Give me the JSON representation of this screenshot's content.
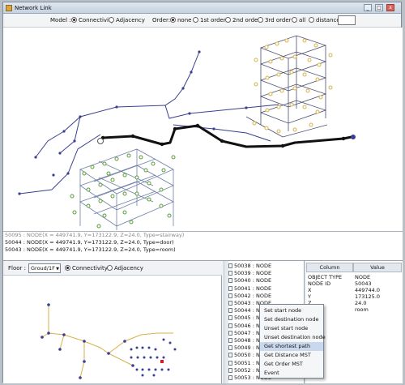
{
  "window": {
    "title": "Network Link",
    "minimize": "_",
    "maximize": "□",
    "close": "x"
  },
  "toolbar": {
    "model_label": "Model :",
    "model_options": [
      "Connectivity",
      "Adjacency"
    ],
    "order_label": "Order:",
    "order_options": [
      "none",
      "1st order",
      "2nd order",
      "3rd order",
      "all",
      "distance"
    ],
    "distance_value": ""
  },
  "log": [
    "50095 : NODE(X = 449741.9, Y=173122.9, Z=24.0, Type=stairway)",
    "50044 : NODE(X = 449741.9, Y=173122.9, Z=24.0, Type=door)",
    "50043 : NODE(X = 449741.9, Y=173122.9, Z=24.0, Type=room)"
  ],
  "floor": {
    "label": "Floor :",
    "selected": "Groud/1F",
    "model_options": [
      "Connectivity",
      "Adjacency"
    ]
  },
  "tree": {
    "items": [
      "50038 : NODE",
      "50039 : NODE",
      "50040 : NODE",
      "50041 : NODE",
      "50042 : NODE",
      "50043 : NODE",
      "50044 : NODE",
      "50045 : NODE",
      "50046 : NODE",
      "50047 : NODE",
      "50048 : NODE",
      "50049 : NODE",
      "50050 : NODE",
      "50051 : NODE",
      "50052 : NODE",
      "50053 : NODE"
    ]
  },
  "properties": {
    "headers": [
      "Column",
      "Value"
    ],
    "rows": [
      [
        "OBJECT TYPE",
        "NODE"
      ],
      [
        "NODE ID",
        "50043"
      ],
      [
        "X",
        "449744.0"
      ],
      [
        "Y",
        "173125.0"
      ],
      [
        "Z",
        "24.0"
      ],
      [
        "",
        "room"
      ]
    ]
  },
  "context_menu": {
    "items": [
      "Set start node",
      "Set destination node",
      "Unset start node",
      "Unset destination node",
      "Get shortest path",
      "Get Distance MST",
      "Get Order MST",
      "Event"
    ],
    "highlighted": "Get shortest path"
  },
  "colors": {
    "path": "#111111",
    "building_green": "#5a9e3a",
    "building_yellow": "#d8b24a",
    "link_blue": "#3a3f8f",
    "selected_node": "#d02020"
  }
}
